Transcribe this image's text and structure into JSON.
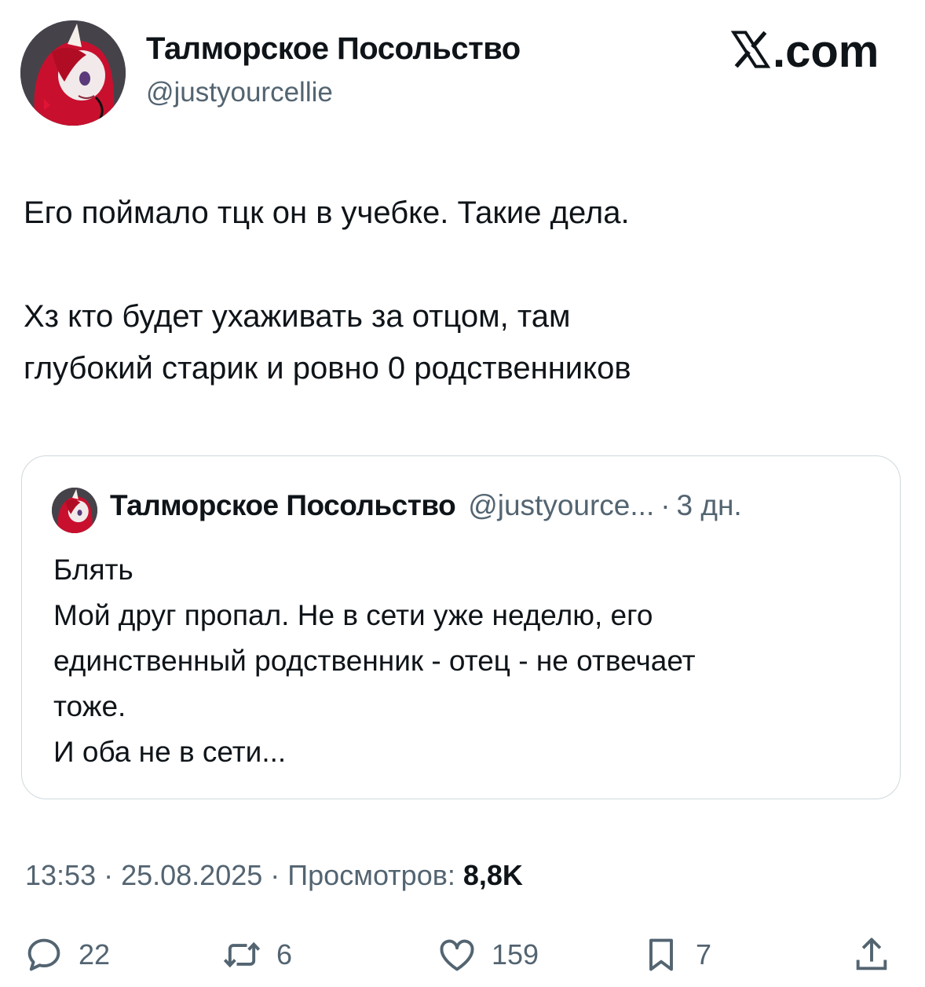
{
  "author": {
    "display_name": "Талморское Посольство",
    "handle": "@justyourcellie"
  },
  "brand": {
    "suffix": ".com"
  },
  "tweet": {
    "text": "Его поймало тцк он в учебке. Такие дела.\n\nХз кто будет ухаживать за отцом, там\nглубокий старик и ровно 0 родственников"
  },
  "quote": {
    "display_name": "Талморское Посольство",
    "handle": "@justyource...",
    "separator": "·",
    "time": "3 дн.",
    "text": "Блять\nМой друг пропал. Не в сети уже неделю, его\nединственный родственник - отец - не отвечает\nтоже.\nИ оба не в сети..."
  },
  "meta": {
    "time": "13:53",
    "date": "25.08.2025",
    "views_label": "Просмотров:",
    "views": "8,8K",
    "sep1": " · ",
    "sep2": " · "
  },
  "actions": {
    "replies": "22",
    "reposts": "6",
    "likes": "159",
    "bookmarks": "7"
  },
  "colors": {
    "text": "#0f1419",
    "secondary": "#536471",
    "border": "#cfd9de"
  },
  "icons": [
    "reply-icon",
    "repost-icon",
    "like-icon",
    "bookmark-icon",
    "share-icon"
  ]
}
